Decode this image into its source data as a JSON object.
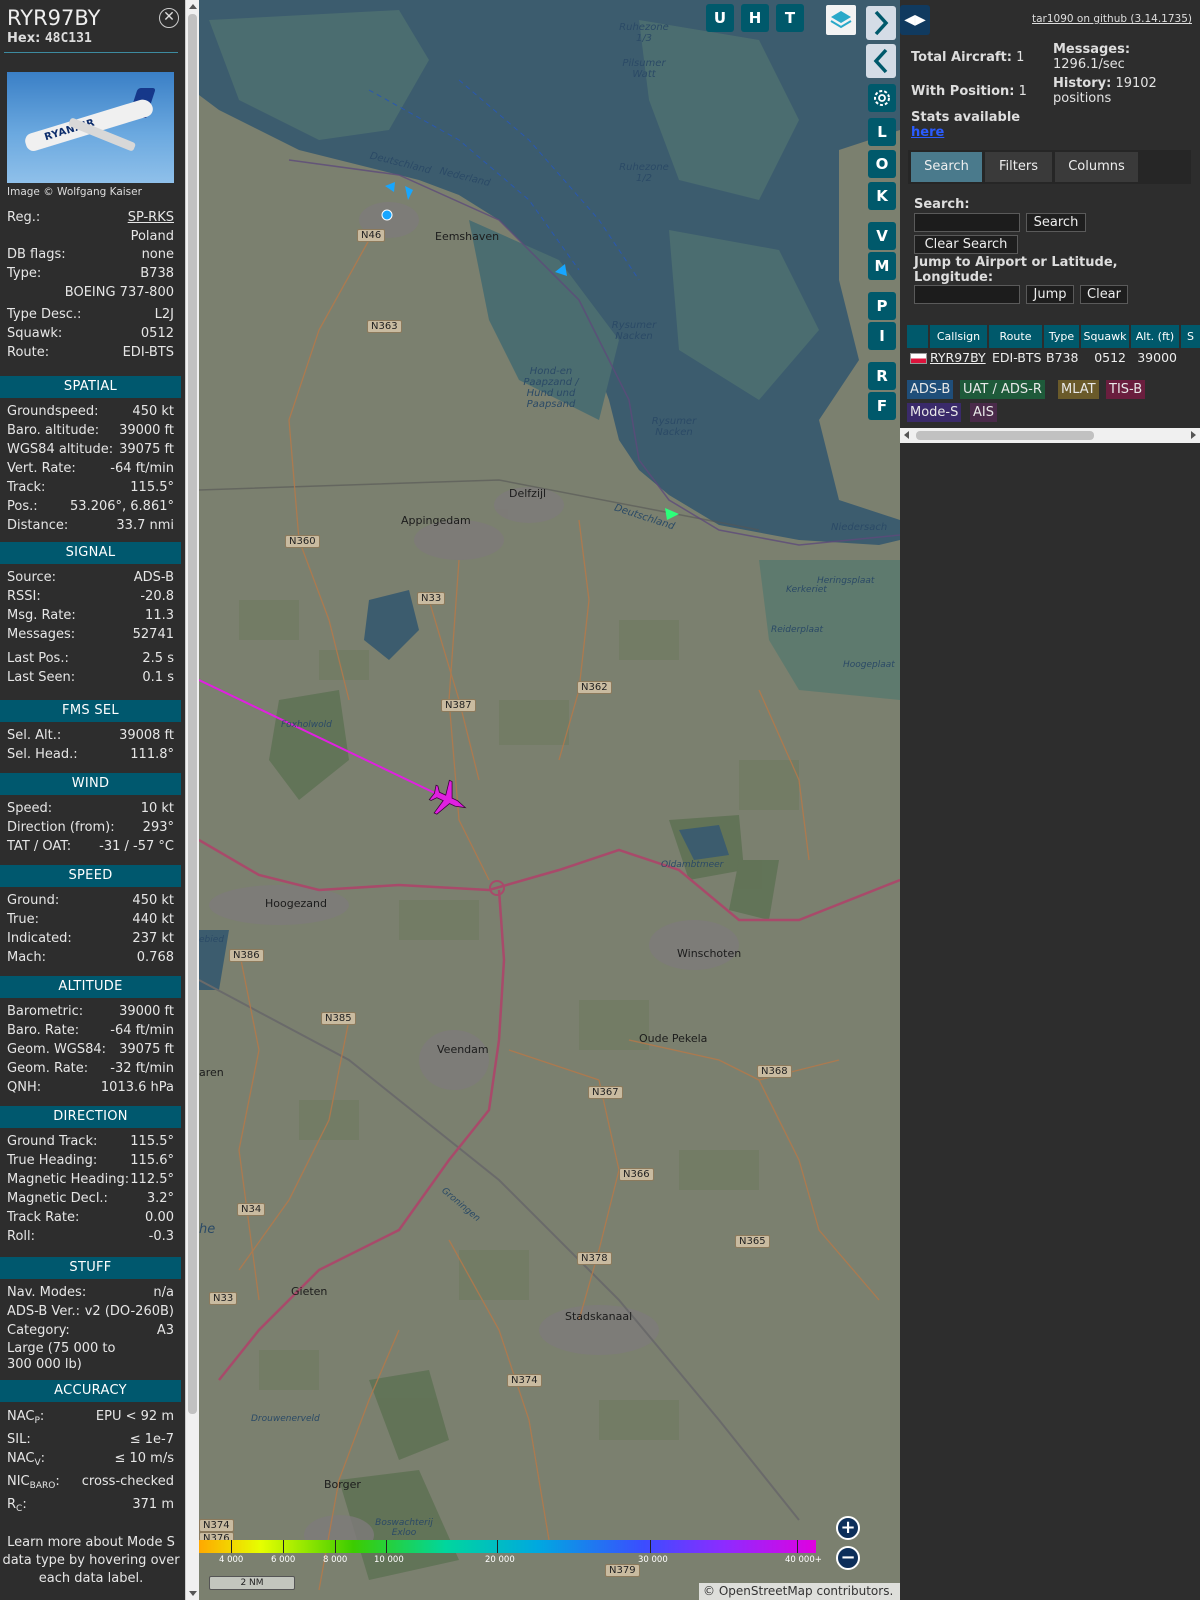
{
  "aircraft": {
    "callsign": "RYR97BY",
    "hex_label": "Hex:",
    "hex": "48C131",
    "photo_airline": "RYANAIR",
    "photo_credit": "Image © Wolfgang Kaiser"
  },
  "info": {
    "reg_label": "Reg.:",
    "reg": "SP-RKS",
    "country": "Poland",
    "dbflags_label": "DB flags:",
    "dbflags": "none",
    "type_label": "Type:",
    "type": "B738",
    "type_full": "BOEING 737-800",
    "typedesc_label": "Type Desc.:",
    "typedesc": "L2J",
    "squawk_label": "Squawk:",
    "squawk": "0512",
    "route_label": "Route:",
    "route": "EDI-BTS"
  },
  "spatial": {
    "title": "SPATIAL",
    "rows": [
      {
        "label": "Groundspeed:",
        "value": "450 kt"
      },
      {
        "label": "Baro. altitude:",
        "value": "39000 ft"
      },
      {
        "label": "WGS84 altitude:",
        "value": "39075 ft"
      },
      {
        "label": "Vert. Rate:",
        "value": "-64 ft/min"
      },
      {
        "label": "Track:",
        "value": "115.5°"
      },
      {
        "label": "Pos.:",
        "value": "53.206°, 6.861°"
      },
      {
        "label": "Distance:",
        "value": "33.7 nmi"
      }
    ]
  },
  "signal": {
    "title": "SIGNAL",
    "rows": [
      {
        "label": "Source:",
        "value": "ADS-B"
      },
      {
        "label": "RSSI:",
        "value": "-20.8"
      },
      {
        "label": "Msg. Rate:",
        "value": "11.3"
      },
      {
        "label": "Messages:",
        "value": "52741"
      },
      {
        "label": "Last Pos.:",
        "value": "2.5 s"
      },
      {
        "label": "Last Seen:",
        "value": "0.1 s"
      }
    ]
  },
  "fms": {
    "title": "FMS SEL",
    "rows": [
      {
        "label": "Sel. Alt.:",
        "value": "39008 ft"
      },
      {
        "label": "Sel. Head.:",
        "value": "111.8°"
      }
    ]
  },
  "wind": {
    "title": "WIND",
    "rows": [
      {
        "label": "Speed:",
        "value": "10 kt"
      },
      {
        "label": "Direction (from):",
        "value": "293°"
      },
      {
        "label": "TAT / OAT:",
        "value": "-31 / -57 °C"
      }
    ]
  },
  "speed": {
    "title": "SPEED",
    "rows": [
      {
        "label": "Ground:",
        "value": "450 kt"
      },
      {
        "label": "True:",
        "value": "440 kt"
      },
      {
        "label": "Indicated:",
        "value": "237 kt"
      },
      {
        "label": "Mach:",
        "value": "0.768"
      }
    ]
  },
  "altitude": {
    "title": "ALTITUDE",
    "rows": [
      {
        "label": "Barometric:",
        "value": "39000 ft"
      },
      {
        "label": "Baro. Rate:",
        "value": "-64 ft/min"
      },
      {
        "label": "Geom. WGS84:",
        "value": "39075 ft"
      },
      {
        "label": "Geom. Rate:",
        "value": "-32 ft/min"
      },
      {
        "label": "QNH:",
        "value": "1013.6 hPa"
      }
    ]
  },
  "direction": {
    "title": "DIRECTION",
    "rows": [
      {
        "label": "Ground Track:",
        "value": "115.5°"
      },
      {
        "label": "True Heading:",
        "value": "115.6°"
      },
      {
        "label": "Magnetic Heading:",
        "value": "112.5°"
      },
      {
        "label": "Magnetic Decl.:",
        "value": "3.2°"
      },
      {
        "label": "Track Rate:",
        "value": "0.00"
      },
      {
        "label": "Roll:",
        "value": "-0.3"
      }
    ]
  },
  "stuff": {
    "title": "STUFF",
    "rows": [
      {
        "label": "Nav. Modes:",
        "value": "n/a"
      },
      {
        "label": "ADS-B Ver.:",
        "value": "v2 (DO-260B)"
      },
      {
        "label": "Category:",
        "value": "A3"
      }
    ],
    "category_desc": "Large (75 000 to 300 000 lb)"
  },
  "accuracy": {
    "title": "ACCURACY",
    "nacp_main": "NAC",
    "nacp_sub": "P",
    "nacp": "EPU < 92 m",
    "sil_label": "SIL:",
    "sil": "≤ 1e-7",
    "nacv_main": "NAC",
    "nacv_sub": "V",
    "nacv": "≤ 10 m/s",
    "nicbaro_main": "NIC",
    "nicbaro_sub": "BARO",
    "nicbaro": "cross-checked",
    "rc_main": "R",
    "rc_sub": "C",
    "rc": "371 m"
  },
  "learn_more": "Learn more about Mode S data type by hovering over each data label.",
  "map": {
    "buttons_top": [
      "U",
      "H",
      "T"
    ],
    "buttons_side": [
      "L",
      "O",
      "K",
      "V",
      "M",
      "P",
      "I",
      "R",
      "F"
    ],
    "labels": {
      "appingedam": "Appingedam",
      "delfzijl": "Delfzijl",
      "eemshaven": "Eemshaven",
      "hoogezand": "Hoogezand",
      "winschoten": "Winschoten",
      "oudepekela": "Oude Pekela",
      "veendam": "Veendam",
      "stadskanaal": "Stadskanaal",
      "gieten": "Gieten",
      "borger": "Borger",
      "oldambtmeer": "Oldambtmeer",
      "deutschland1": "Deutschland",
      "nederland": "Nederland",
      "deutschland2": "Deutschland",
      "niedersach": "Niedersach",
      "ruhezone13": "Ruhezone 1/3",
      "ruhezone12": "Ruhezone 1/2",
      "pilsumer": "Pilsumer Watt",
      "rysumer1": "Rysumer Nacken",
      "rysumer2": "Rysumer Nacken",
      "hondpaap": "Hond-en Paapzand / Hund und Paapsand",
      "heringsplaat": "Heringsplaat",
      "kerkeriet": "Kerkeriet",
      "reiderplaat": "Reiderplaat",
      "hoogeplaat": "Hoogeplaat",
      "foxholwold": "Foxholwold",
      "drouwenerveld": "Drouwenerveld",
      "boswachterij": "Boswachterij Exloo",
      "groningen": "Groningen",
      "ebied": "ebied",
      "aren": "aren",
      "he": "he"
    },
    "roads": {
      "n46": "N46",
      "n363": "N363",
      "n360": "N360",
      "n33a": "N33",
      "n387": "N387",
      "n362": "N362",
      "n386": "N386",
      "n385": "N385",
      "n367": "N367",
      "n368": "N368",
      "n366": "N366",
      "n34": "N34",
      "n365": "N365",
      "n378": "N378",
      "n33b": "N33",
      "n374a": "N374",
      "n374b": "N374",
      "n376": "N376",
      "n379": "N379"
    },
    "altitude_legend": [
      "4 000",
      "6 000",
      "8 000",
      "10 000",
      "20 000",
      "30 000",
      "40 000+"
    ],
    "scale": "2 NM",
    "attribution": "© OpenStreetMap contributors."
  },
  "side": {
    "github": "tar1090 on github (3.14.1735)",
    "total_label": "Total Aircraft:",
    "total": "1",
    "withpos_label": "With Position:",
    "withpos": "1",
    "messages_label": "Messages:",
    "messages": "1296.1/sec",
    "history_label": "History:",
    "history": "19102 positions",
    "stats_label": "Stats available",
    "stats_link": "here",
    "tabs": [
      "Search",
      "Filters",
      "Columns"
    ],
    "search_label": "Search:",
    "search_btn": "Search",
    "clear_search": "Clear Search",
    "jump_label": "Jump to Airport or Latitude, Longitude:",
    "jump_btn": "Jump",
    "clear_btn": "Clear",
    "columns": [
      "Callsign",
      "Route",
      "Type",
      "Squawk",
      "Alt. (ft)",
      "S"
    ],
    "row": {
      "callsign": "RYR97BY",
      "route": "EDI-BTS",
      "type": "B738",
      "squawk": "0512",
      "alt": "39000"
    },
    "badges": [
      "ADS-B",
      "UAT / ADS-R",
      "MLAT",
      "TIS-B",
      "Mode-S",
      "AIS"
    ]
  },
  "colors": {
    "section": "#00586e",
    "track": "#e020e0",
    "aircraft": "#e020e0",
    "badge_adsb": "#1f4e79",
    "badge_uat": "#1e5a3a",
    "badge_mlat": "#6a5a2a",
    "badge_tisb": "#6a1e3e",
    "badge_modes": "#3a2a6a",
    "badge_ais": "#4a2a4a"
  }
}
